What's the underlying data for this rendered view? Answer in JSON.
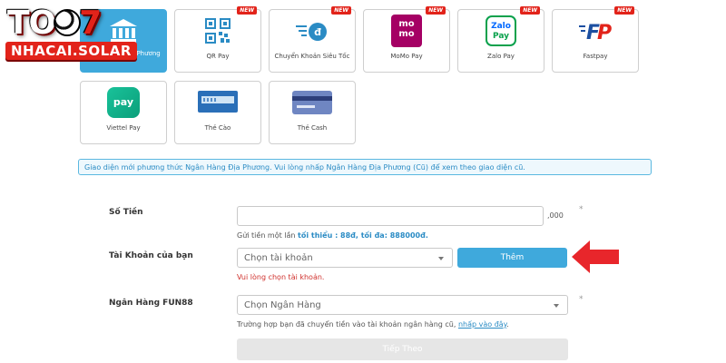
{
  "logo": {
    "top_text_a": "TO",
    "top_text_b": "7",
    "sub_text": "NHACAI.SOLAR"
  },
  "colors": {
    "accent": "#3fa9dc",
    "error": "#d0312d",
    "arrow": "#e8262b",
    "new_badge": "#e2231a"
  },
  "methods_row1": [
    {
      "label": "Ngân Hàng Địa Phương",
      "icon": "bank-icon",
      "active": true,
      "badge": ""
    },
    {
      "label": "QR Pay",
      "icon": "qr-code-icon",
      "active": false,
      "badge": "NEW"
    },
    {
      "label": "Chuyển Khoản Siêu Tốc",
      "icon": "fast-transfer-icon",
      "active": false,
      "badge": "NEW"
    },
    {
      "label": "MoMo Pay",
      "icon": "momo-icon",
      "active": false,
      "badge": "NEW"
    },
    {
      "label": "Zalo Pay",
      "icon": "zalo-pay-icon",
      "active": false,
      "badge": "NEW"
    },
    {
      "label": "Fastpay",
      "icon": "fastpay-icon",
      "active": false,
      "badge": "NEW"
    }
  ],
  "methods_row2": [
    {
      "label": "Viettel Pay",
      "icon": "viettel-pay-icon"
    },
    {
      "label": "Thẻ Cào",
      "icon": "scratch-card-icon"
    },
    {
      "label": "Thẻ Cash",
      "icon": "cash-card-icon"
    }
  ],
  "logo_text": {
    "momo_a": "mo",
    "momo_b": "mo",
    "zalo_a": "Zalo",
    "zalo_b": "Pay",
    "viettel": "pay"
  },
  "notice": "Giao diện mới phương thức Ngân Hàng Địa Phương. Vui lòng nhấp Ngân Hàng Địa Phương (Cũ) để xem theo giao diện cũ.",
  "form": {
    "amount_label": "Số Tiền",
    "amount_value": "",
    "amount_suffix": ",000",
    "amount_help_prefix": "Gửi tiền một lần",
    "amount_help_limits": "tối thiểu : 88đ, tối đa: 888000đ.",
    "account_label": "Tài Khoản của bạn",
    "account_placeholder": "Chọn tài khoản",
    "account_error": "Vui lòng chọn tài khoản.",
    "add_button": "Thêm",
    "bank_label": "Ngân Hàng FUN88",
    "bank_placeholder": "Chọn Ngân Hàng",
    "bank_help": "Trường hợp bạn đã chuyển tiền vào tài khoản ngân hàng cũ,",
    "bank_help_link": "nhấp vào đây",
    "bank_help_end": ".",
    "next_button": "Tiếp Theo",
    "required_mark": "*"
  }
}
